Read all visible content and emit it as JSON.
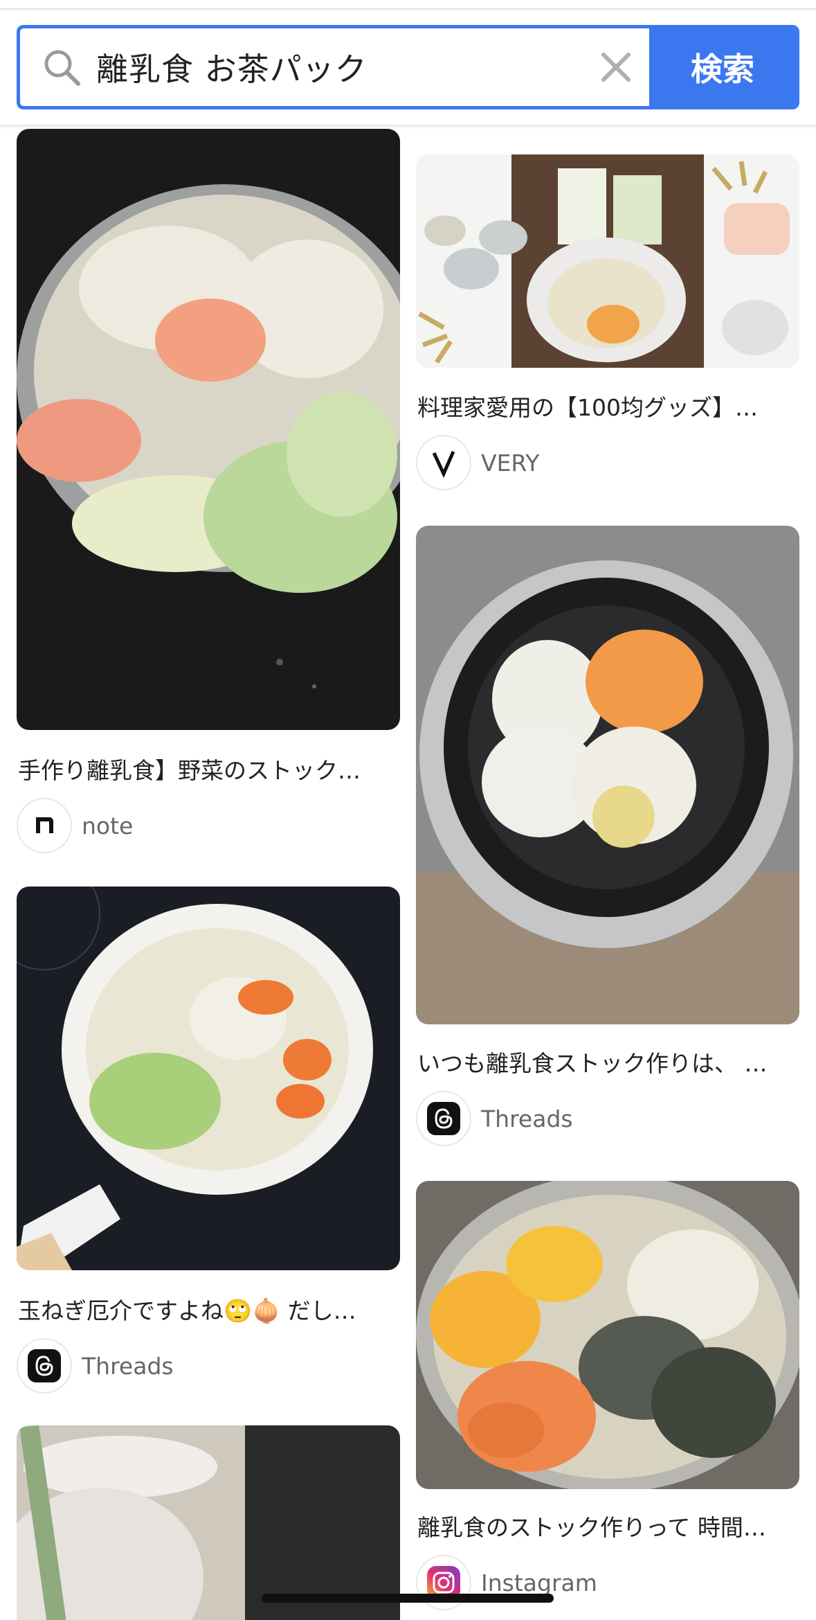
{
  "search": {
    "query": "離乳食 お茶パック",
    "button_label": "検索",
    "icon": "search-icon",
    "clear_icon": "close-icon"
  },
  "feed": {
    "left_column": [
      {
        "title": "手作り離乳食】野菜のストック…",
        "source": "note",
        "source_icon": "note-logo-icon"
      },
      {
        "title": "玉ねぎ厄介ですよね🙄🧅 だし…",
        "source": "Threads",
        "source_icon": "threads-logo-icon"
      }
    ],
    "right_column": [
      {
        "title": "料理家愛用の【100均グッズ】…",
        "source": "VERY",
        "source_icon": "very-logo-icon"
      },
      {
        "title": "いつも離乳食ストック作りは、 …",
        "source": "Threads",
        "source_icon": "threads-logo-icon"
      },
      {
        "title": "離乳食のストック作りって 時間…",
        "source": "Instagram",
        "source_icon": "instagram-logo-icon"
      }
    ]
  },
  "colors": {
    "accent": "#3b78f0",
    "source_text": "#666666"
  }
}
